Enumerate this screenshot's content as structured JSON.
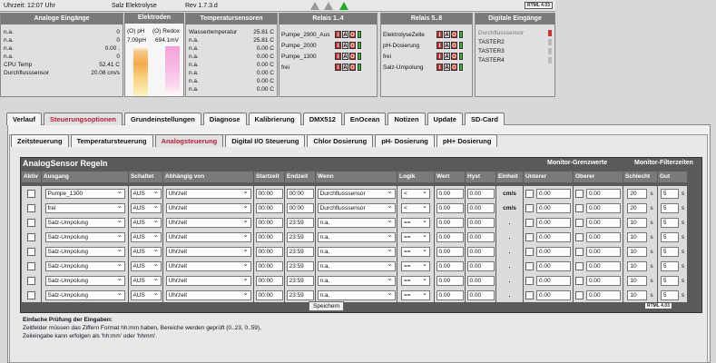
{
  "header": {
    "time": "Uhrzeit: 12:07 Uhr",
    "device": "Salz Elektrolyse",
    "rev": "Rev 1.7.3.d",
    "logo": "RTML 4.03"
  },
  "analog": {
    "title": "Analoge Eingänge",
    "rows": [
      [
        "n.a.",
        "0"
      ],
      [
        "n.a.",
        "0"
      ],
      [
        "n.a.",
        "0.00 ."
      ],
      [
        "n.a.",
        "0"
      ],
      [
        "CPU Temp",
        "52.41 C"
      ],
      [
        "Durchflusssensor",
        "20.08 cm/s"
      ]
    ]
  },
  "elektroden": {
    "title": "Elektroden",
    "ph_label": "(O) pH",
    "ph_value": "7.09pH",
    "redox_label": "(O) Redox",
    "redox_value": "694.1mV"
  },
  "temp": {
    "title": "Temperatursensoren",
    "rows": [
      [
        "Wassertemperatur",
        "25.81 C"
      ],
      [
        "n.a.",
        "25.81 C"
      ],
      [
        "n.a.",
        "0.00 C"
      ],
      [
        "n.a.",
        "0.00 C"
      ],
      [
        "n.a.",
        "0.00 C"
      ],
      [
        "n.a.",
        "0.00 C"
      ],
      [
        "n.a.",
        "0.00 C"
      ],
      [
        "n.a.",
        "0.00 C"
      ]
    ]
  },
  "relais14": {
    "title": "Relais 1..4",
    "rows": [
      "Pumpe_2900_Aus",
      "Pumpe_2000",
      "Pumpe_1300",
      "frei"
    ]
  },
  "relais58": {
    "title": "Relais 5..8",
    "rows": [
      "ElektrolyseZelle",
      "pH-Dosierung",
      "frei",
      "Salz-Umpolung"
    ]
  },
  "digital": {
    "title": "Digitale Eingänge",
    "rows": [
      "Durchflusssensor",
      "TASTER2",
      "TASTER3",
      "TASTER4"
    ]
  },
  "iao": {
    "i": "I",
    "a": "A",
    "o": "O"
  },
  "tabs": [
    "Verlauf",
    "Steuerungsoptionen",
    "Grundeinstellungen",
    "Diagnose",
    "Kalibrierung",
    "DMX512",
    "EnOcean",
    "Notizen",
    "Update",
    "SD-Card"
  ],
  "subtabs": [
    "Zeitsteuerung",
    "Temperatursteuerung",
    "Analogsteuerung",
    "Digital I/O Steuerung",
    "Chlor Dosierung",
    "pH- Dosierung",
    "pH+ Dosierung"
  ],
  "grid": {
    "title": "AnalogSensor Regeln",
    "sec_grenz": "Monitor-Grenzwerte",
    "sec_filter": "Monitor-Filterzeiten",
    "headers": [
      "Aktiv",
      "Ausgang",
      "Schaltet",
      "Abhängig von",
      "Startzeit",
      "Endzeit",
      "Wenn",
      "Logik",
      "Wert",
      "Hyst",
      "Einheit",
      "Unterer",
      "Oberer",
      "Schlecht",
      "Gut"
    ],
    "rows": [
      [
        "Pumpe_1300",
        "AUS",
        "Uhrzeit",
        "00:00",
        "00:00",
        "Durchflusssensor",
        "<",
        "0.00",
        "0.00",
        "cm/s",
        "0.00",
        "0.00",
        "20",
        "5"
      ],
      [
        "frei",
        "AUS",
        "Uhrzeit",
        "00:00",
        "00:00",
        "Durchflusssensor",
        "<",
        "0.00",
        "0.00",
        "cm/s",
        "0.00",
        "0.00",
        "20",
        "5"
      ],
      [
        "Salz-Umpolung",
        "AUS",
        "Uhrzeit",
        "00:00",
        "23:59",
        "n.a.",
        "==",
        "0.00",
        "0.00",
        ".",
        "0.00",
        "0.00",
        "10",
        "5"
      ],
      [
        "Salz-Umpolung",
        "AUS",
        "Uhrzeit",
        "00:00",
        "23:59",
        "n.a.",
        "==",
        "0.00",
        "0.00",
        ".",
        "0.00",
        "0.00",
        "10",
        "5"
      ],
      [
        "Salz-Umpolung",
        "AUS",
        "Uhrzeit",
        "00:00",
        "23:59",
        "n.a.",
        "==",
        "0.00",
        "0.00",
        ".",
        "0.00",
        "0.00",
        "10",
        "5"
      ],
      [
        "Salz-Umpolung",
        "AUS",
        "Uhrzeit",
        "00:00",
        "23:59",
        "n.a.",
        "==",
        "0.00",
        "0.00",
        ".",
        "0.00",
        "0.00",
        "10",
        "5"
      ],
      [
        "Salz-Umpolung",
        "AUS",
        "Uhrzeit",
        "00:00",
        "23:59",
        "n.a.",
        "==",
        "0.00",
        "0.00",
        ".",
        "0.00",
        "0.00",
        "10",
        "5"
      ],
      [
        "Salz-Umpolung",
        "AUS",
        "Uhrzeit",
        "00:00",
        "23:59",
        "n.a.",
        "==",
        "0.00",
        "0.00",
        ".",
        "0.00",
        "0.00",
        "10",
        "5"
      ]
    ],
    "unit_s": "s",
    "save": "Speichern"
  },
  "footer": {
    "title": "Einfache Prüfung der Eingaben:",
    "line1": "Zeitfelder müssen das Ziffern Format hh:mm haben, Bereiche werden geprüft (0..23, 0..59),",
    "line2": "Zeileingabe kann erfolgen als 'hh:mm' oder 'hhmm'."
  }
}
